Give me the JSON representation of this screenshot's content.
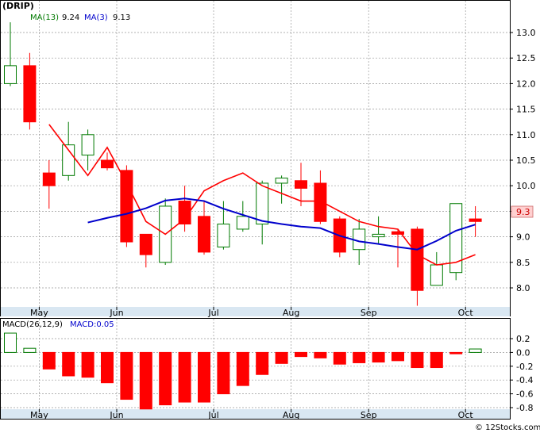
{
  "title": "(DRIP)",
  "legend": {
    "ma13_label": "MA(13)",
    "ma13_value": "9.24",
    "ma3_label": "MA(3)",
    "ma3_value": "9.13",
    "macd_label": "MACD(26,12,9)",
    "macd_value_label": "MACD:0.05"
  },
  "last_price_label": "9.3",
  "watermark": "© 12Stocks.com",
  "colors": {
    "up_candle_border": "#007a00",
    "up_candle_fill": "#ffffff",
    "down_candle": "#ff0000",
    "ma3": "#ff0000",
    "ma13": "#0000cc",
    "legend_title": "#000000",
    "legend_ma13": "#007a00",
    "legend_ma3": "#0000cc",
    "grid": "#999999",
    "axis_band": "#d9e7f2",
    "price_tag_bg": "#ffd0d0",
    "price_tag_text": "#cc0000",
    "macd_pos_fill": "#ffffff",
    "macd_pos_border": "#007a00",
    "macd_neg": "#ff0000"
  },
  "chart_data": [
    {
      "type": "candlestick",
      "name": "price",
      "x_tick_labels": [
        "May",
        "Jun",
        "Jul",
        "Aug",
        "Sep",
        "Oct"
      ],
      "x_tick_index": [
        1,
        5,
        10,
        14,
        18,
        23
      ],
      "y_ticks": [
        8.0,
        8.5,
        9.0,
        9.5,
        10.0,
        10.5,
        11.0,
        11.5,
        12.0,
        12.5,
        13.0
      ],
      "ylim": [
        7.6,
        13.2
      ],
      "grid": true,
      "candles": [
        {
          "o": 12.0,
          "h": 13.2,
          "l": 11.95,
          "c": 12.35
        },
        {
          "o": 12.35,
          "h": 12.6,
          "l": 11.1,
          "c": 11.25
        },
        {
          "o": 10.25,
          "h": 10.5,
          "l": 9.55,
          "c": 10.0
        },
        {
          "o": 10.2,
          "h": 11.25,
          "l": 10.1,
          "c": 10.8
        },
        {
          "o": 10.6,
          "h": 11.1,
          "l": 10.3,
          "c": 11.0
        },
        {
          "o": 10.5,
          "h": 10.65,
          "l": 10.3,
          "c": 10.35
        },
        {
          "o": 10.3,
          "h": 10.4,
          "l": 8.8,
          "c": 8.9
        },
        {
          "o": 9.05,
          "h": 9.05,
          "l": 8.4,
          "c": 8.65
        },
        {
          "o": 8.5,
          "h": 9.75,
          "l": 8.45,
          "c": 9.6
        },
        {
          "o": 9.7,
          "h": 10.0,
          "l": 9.1,
          "c": 9.25
        },
        {
          "o": 9.4,
          "h": 9.7,
          "l": 8.65,
          "c": 8.7
        },
        {
          "o": 8.8,
          "h": 9.7,
          "l": 8.75,
          "c": 9.25
        },
        {
          "o": 9.15,
          "h": 9.7,
          "l": 9.1,
          "c": 9.4
        },
        {
          "o": 9.25,
          "h": 10.1,
          "l": 8.85,
          "c": 10.05
        },
        {
          "o": 10.05,
          "h": 10.2,
          "l": 9.65,
          "c": 10.15
        },
        {
          "o": 10.1,
          "h": 10.45,
          "l": 9.6,
          "c": 9.95
        },
        {
          "o": 10.05,
          "h": 10.3,
          "l": 9.25,
          "c": 9.3
        },
        {
          "o": 9.35,
          "h": 9.4,
          "l": 8.6,
          "c": 8.7
        },
        {
          "o": 8.75,
          "h": 9.35,
          "l": 8.45,
          "c": 9.15
        },
        {
          "o": 9.0,
          "h": 9.4,
          "l": 8.85,
          "c": 9.05
        },
        {
          "o": 9.1,
          "h": 9.15,
          "l": 8.4,
          "c": 9.05
        },
        {
          "o": 9.15,
          "h": 9.2,
          "l": 7.65,
          "c": 7.95
        },
        {
          "o": 8.05,
          "h": 8.7,
          "l": 8.05,
          "c": 8.45
        },
        {
          "o": 8.3,
          "h": 9.65,
          "l": 8.15,
          "c": 9.65
        },
        {
          "o": 9.35,
          "h": 9.6,
          "l": 9.0,
          "c": 9.3
        }
      ],
      "ma3": [
        null,
        null,
        11.2,
        10.7,
        10.2,
        10.75,
        10.05,
        9.3,
        9.05,
        9.35,
        9.9,
        10.1,
        10.25,
        10.0,
        9.85,
        9.7,
        9.7,
        9.5,
        9.3,
        9.2,
        9.15,
        8.65,
        8.45,
        8.5,
        8.65
      ],
      "ma13": [
        null,
        null,
        null,
        null,
        9.28,
        9.37,
        9.45,
        9.56,
        9.71,
        9.75,
        9.7,
        9.55,
        9.43,
        9.31,
        9.25,
        9.2,
        9.17,
        9.02,
        8.91,
        8.86,
        8.8,
        8.75,
        8.92,
        9.12,
        9.24
      ]
    },
    {
      "type": "bar",
      "name": "MACD",
      "y_ticks": [
        0.2,
        0.0,
        -0.2,
        -0.4,
        -0.6,
        -0.8
      ],
      "ylim": [
        -0.85,
        0.32
      ],
      "values": [
        0.28,
        0.06,
        -0.24,
        -0.34,
        -0.36,
        -0.44,
        -0.68,
        -0.82,
        -0.76,
        -0.72,
        -0.72,
        -0.6,
        -0.48,
        -0.32,
        -0.16,
        -0.06,
        -0.08,
        -0.17,
        -0.15,
        -0.14,
        -0.12,
        -0.22,
        -0.22,
        -0.02,
        0.05
      ]
    }
  ]
}
